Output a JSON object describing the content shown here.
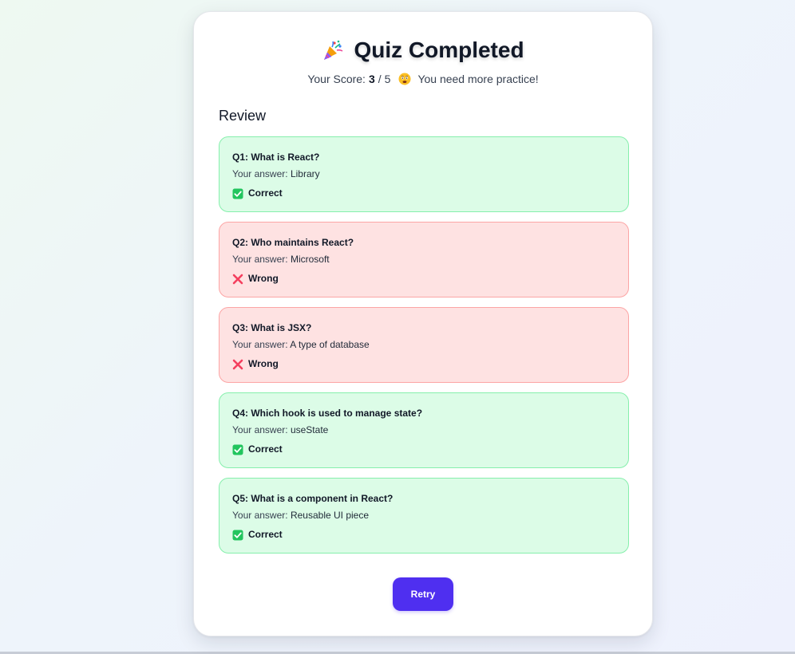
{
  "header": {
    "title": "Quiz Completed",
    "title_icon": "party-popper-icon"
  },
  "score": {
    "label": "Your Score:",
    "value": "3",
    "separator": "/",
    "total": "5",
    "feedback_icon": "worried-face-icon",
    "message": "You need more practice!"
  },
  "review": {
    "heading": "Review",
    "answer_label": "Your answer:",
    "items": [
      {
        "question": "Q1: What is React?",
        "answer": "Library",
        "status": "Correct",
        "correct": true
      },
      {
        "question": "Q2: Who maintains React?",
        "answer": "Microsoft",
        "status": "Wrong",
        "correct": false
      },
      {
        "question": "Q3: What is JSX?",
        "answer": "A type of database",
        "status": "Wrong",
        "correct": false
      },
      {
        "question": "Q4: Which hook is used to manage state?",
        "answer": "useState",
        "status": "Correct",
        "correct": true
      },
      {
        "question": "Q5: What is a component in React?",
        "answer": "Reusable UI piece",
        "status": "Correct",
        "correct": true
      }
    ]
  },
  "actions": {
    "retry_label": "Retry"
  },
  "colors": {
    "accent": "#4f2ff0",
    "correct_bg": "#dcfce7",
    "correct_border": "#86efac",
    "wrong_bg": "#fee2e2",
    "wrong_border": "#fca5a5",
    "check_green": "#22c55e",
    "cross_red": "#f43f5e"
  }
}
